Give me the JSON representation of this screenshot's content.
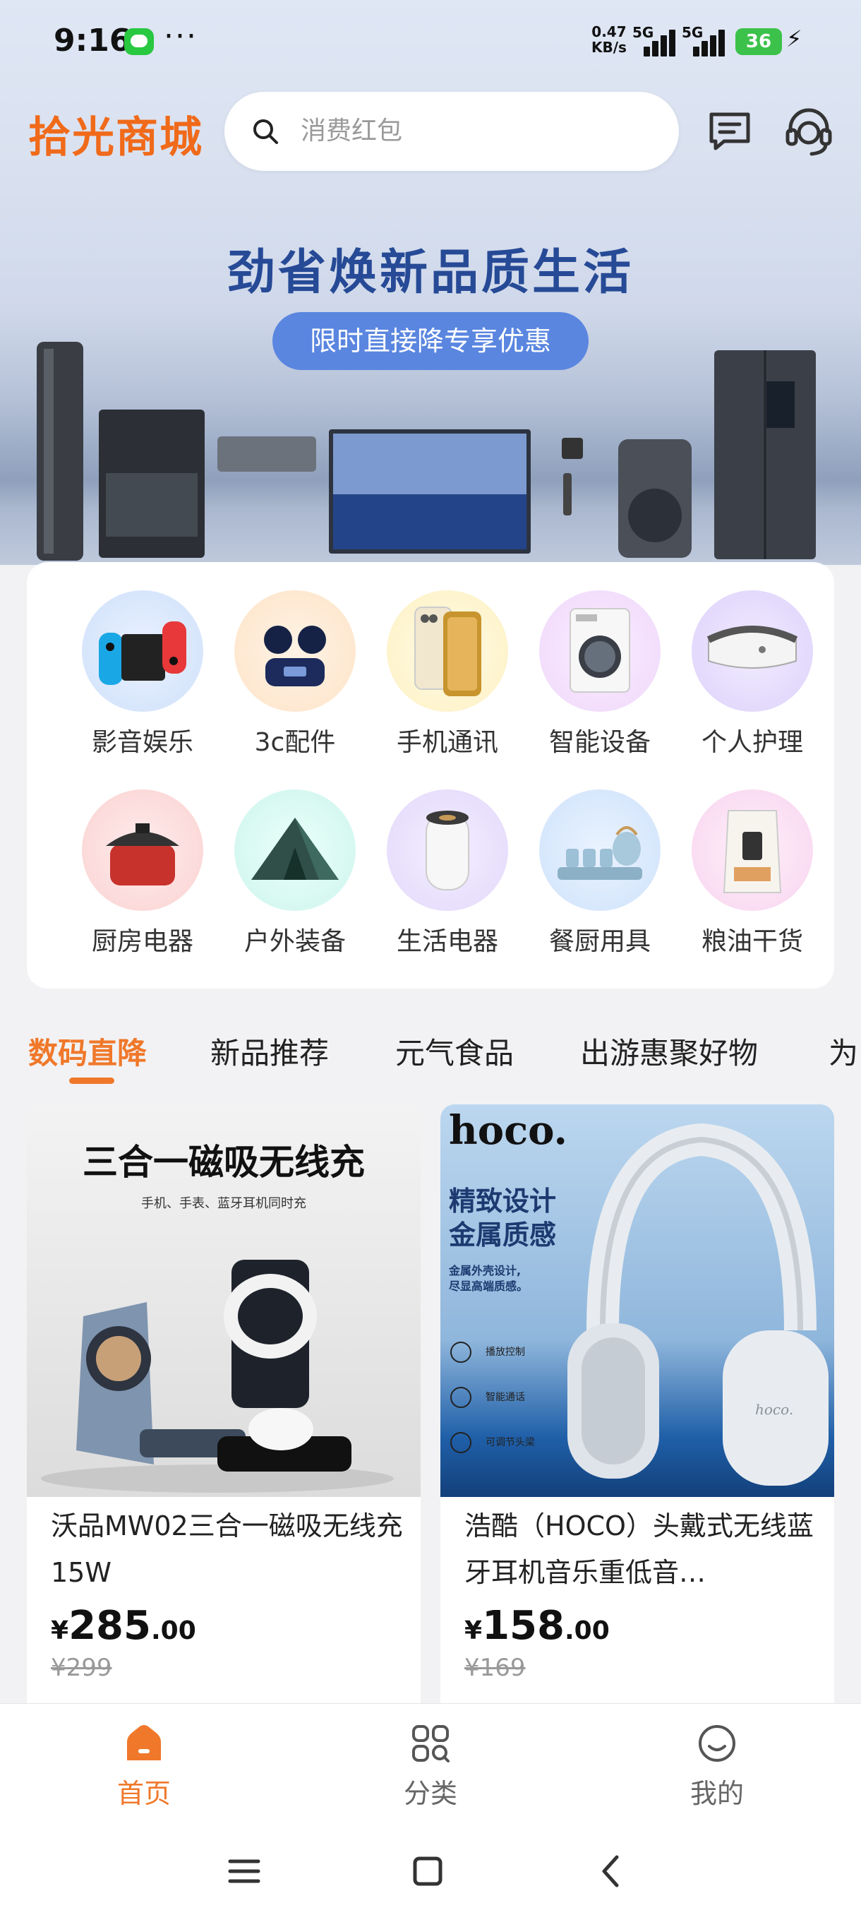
{
  "status_bar": {
    "time": "9:16",
    "dots": "···",
    "speed_value": "0.47",
    "speed_unit": "KB/s",
    "net1": "5G",
    "net2": "5G",
    "battery": "36"
  },
  "header": {
    "logo": "拾光商城",
    "search_placeholder": "消费红包"
  },
  "banner": {
    "title": "劲省焕新品质生活",
    "pill": "限时直接降专享优惠"
  },
  "categories": [
    {
      "label": "影音娱乐",
      "icon": "game-console-icon"
    },
    {
      "label": "3c配件",
      "icon": "earbuds-icon"
    },
    {
      "label": "手机通讯",
      "icon": "phone-icon"
    },
    {
      "label": "智能设备",
      "icon": "washing-machine-icon"
    },
    {
      "label": "个人护理",
      "icon": "eye-massager-icon"
    },
    {
      "label": "厨房电器",
      "icon": "pressure-cooker-icon"
    },
    {
      "label": "户外装备",
      "icon": "tent-icon"
    },
    {
      "label": "生活电器",
      "icon": "humidifier-icon"
    },
    {
      "label": "餐厨用具",
      "icon": "tea-set-icon"
    },
    {
      "label": "粮油干货",
      "icon": "rice-bag-icon"
    }
  ],
  "tabs": [
    {
      "label": "数码直降",
      "active": true
    },
    {
      "label": "新品推荐",
      "active": false
    },
    {
      "label": "元气食品",
      "active": false
    },
    {
      "label": "出游惠聚好物",
      "active": false
    },
    {
      "label": "为",
      "active": false
    }
  ],
  "products": [
    {
      "image_title": "三合一磁吸无线充",
      "image_subtitle": "手机、手表、蓝牙耳机同时充",
      "name": "沃品MW02三合一磁吸无线充15W",
      "price_currency": "¥",
      "price_int": "285",
      "price_dec": ".00",
      "old_price": "¥299"
    },
    {
      "image_brand": "hoco.",
      "image_line1": "精致设计",
      "image_line2": "金属质感",
      "image_desc1": "金属外壳设计,",
      "image_desc2": "尽显高端质感。",
      "image_feat1": "播放控制",
      "image_feat2": "智能通话",
      "image_feat3": "可调节头梁",
      "image_model": "hoco.",
      "name": "浩酷（HOCO）头戴式无线蓝牙耳机音乐重低音…",
      "price_currency": "¥",
      "price_int": "158",
      "price_dec": ".00",
      "old_price": "¥169"
    }
  ],
  "bottom_nav": [
    {
      "label": "首页",
      "icon": "home-icon",
      "active": true
    },
    {
      "label": "分类",
      "icon": "category-icon",
      "active": false
    },
    {
      "label": "我的",
      "icon": "profile-icon",
      "active": false
    }
  ],
  "colors": {
    "brand": "#f06a1a",
    "accent": "#f0782a",
    "banner_title": "#264a96",
    "banner_pill": "#5a86e0"
  }
}
